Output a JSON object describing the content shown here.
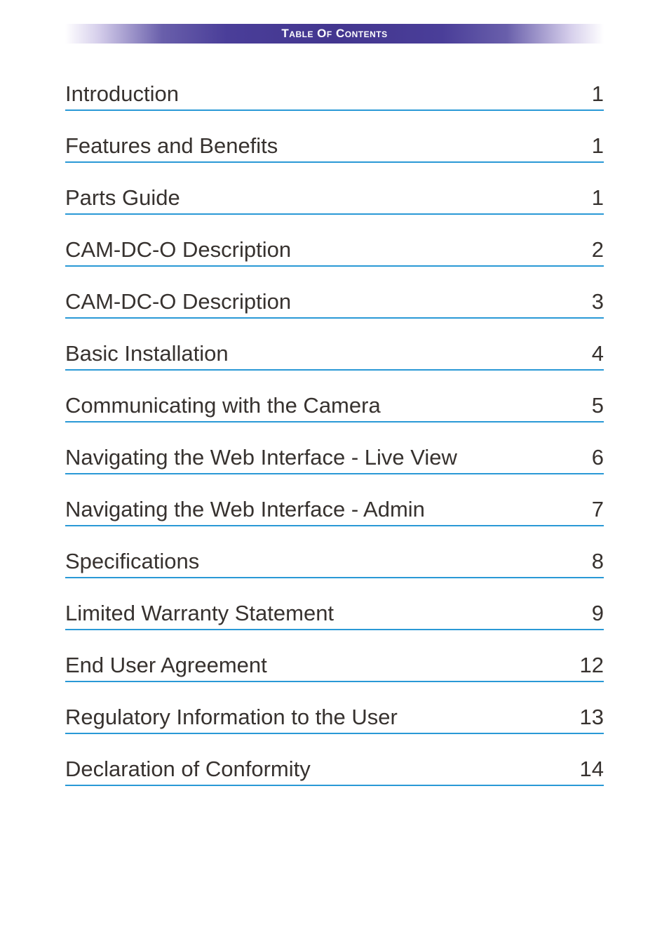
{
  "header": {
    "title": "Table Of Contents"
  },
  "toc": {
    "entries": [
      {
        "title": "Introduction",
        "page": "1"
      },
      {
        "title": "Features and Benefits",
        "page": "1"
      },
      {
        "title": "Parts Guide",
        "page": "1"
      },
      {
        "title": "CAM-DC-O Description",
        "page": "2"
      },
      {
        "title": "CAM-DC-O Description",
        "page": "3"
      },
      {
        "title": "Basic Installation",
        "page": "4"
      },
      {
        "title": "Communicating with the Camera",
        "page": "5"
      },
      {
        "title": "Navigating the Web Interface - Live View",
        "page": "6"
      },
      {
        "title": "Navigating the Web Interface - Admin",
        "page": "7"
      },
      {
        "title": "Specifications",
        "page": "8"
      },
      {
        "title": "Limited Warranty Statement",
        "page": "9"
      },
      {
        "title": "End User Agreement",
        "page": "12"
      },
      {
        "title": "Regulatory Information to the User",
        "page": "13"
      },
      {
        "title": "Declaration of Conformity",
        "page": "14"
      }
    ]
  }
}
